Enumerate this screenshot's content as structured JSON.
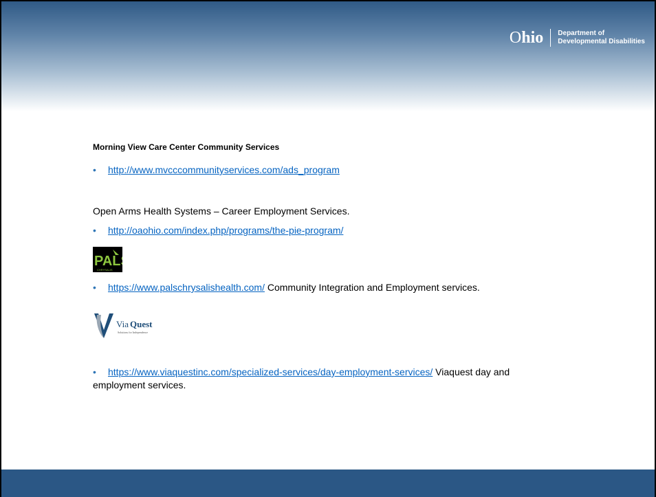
{
  "header": {
    "logo_word_light": "O",
    "logo_word_bold": "hio",
    "logo_dept_line1": "Department of",
    "logo_dept_line2": "Developmental Disabilities"
  },
  "section1": {
    "heading": "Morning View Care Center Community Services",
    "bullet": "•",
    "link": "http://www.mvcccommunityservices.com/ads_program"
  },
  "section2": {
    "text": "Open Arms Health Systems – Career Employment Services.",
    "bullet": "•",
    "link": "http://oaohio.com/index.php/programs/the-pie-program/"
  },
  "section3": {
    "logo_text": "PALS",
    "logo_subtext": "CHRYSALIS",
    "bullet": "•",
    "link": "https://www.palschrysalishealth.com/",
    "suffix": " Community Integration and Employment services."
  },
  "section4": {
    "logo_text_light": "Via",
    "logo_text_bold": "Quest",
    "logo_tagline": "Solutions for Independence",
    "bullet": "•",
    "link": "https://www.viaquestinc.com/specialized-services/day-employment-services/",
    "suffix": " Viaquest day and",
    "continuation": "employment services."
  },
  "colors": {
    "header_dark": "#2f5a86",
    "footer": "#2b5785",
    "link": "#0563c1",
    "bullet": "#2e75b6",
    "pals_green": "#8dc63f"
  }
}
